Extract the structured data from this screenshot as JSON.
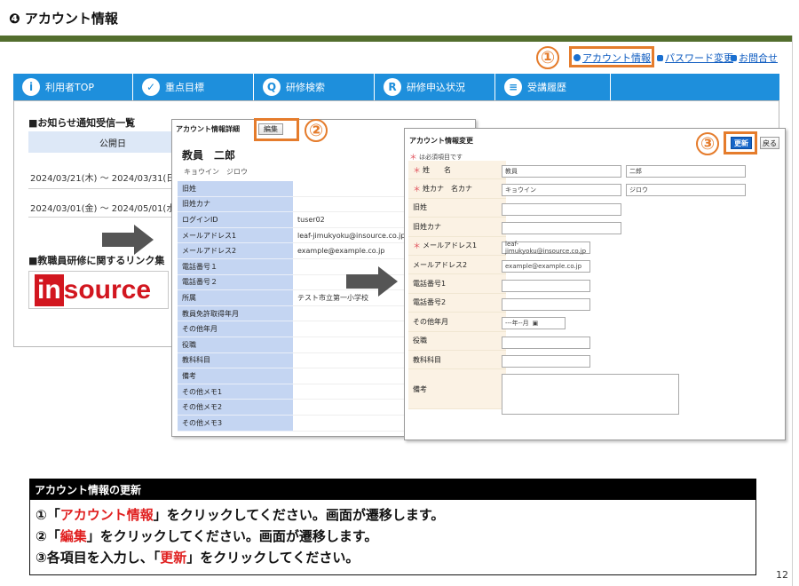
{
  "slide": {
    "title": "❹ アカウント情報",
    "page_number": "12"
  },
  "top_links": {
    "account": "アカウント情報",
    "password": "パスワード変更",
    "contact": "お問合せ"
  },
  "steps": {
    "one": "①",
    "two": "②",
    "three": "③"
  },
  "nav": {
    "items": [
      {
        "icon": "i",
        "label": "利用者TOP"
      },
      {
        "icon": "✓",
        "label": "重点目標"
      },
      {
        "icon": "Q",
        "label": "研修検索"
      },
      {
        "icon": "R",
        "label": "研修申込状況"
      },
      {
        "icon": "≡",
        "label": "受講履歴"
      }
    ]
  },
  "user_panel": {
    "notice_heading": "■お知らせ通知受信一覧",
    "notice_col": "公開日",
    "notice_rows": [
      "2024/03/21(木) ～ 2024/03/31(日)",
      "2024/03/01(金) ～ 2024/05/01(水)"
    ],
    "links_heading": "■教職員研修に関するリンク集",
    "logo_in": "in",
    "logo_rest": "source"
  },
  "detail": {
    "title": "アカウント情報詳細",
    "edit_button": "編集",
    "name": "教員　二郎",
    "kana": "キョウイン　ジロウ",
    "rows": [
      {
        "label": "旧姓",
        "value": ""
      },
      {
        "label": "旧姓カナ",
        "value": ""
      },
      {
        "label": "ログインID",
        "value": "tuser02"
      },
      {
        "label": "メールアドレス1",
        "value": "leaf-jimukyoku@insource.co.jp"
      },
      {
        "label": "メールアドレス2",
        "value": "example@example.co.jp"
      },
      {
        "label": "電話番号１",
        "value": ""
      },
      {
        "label": "電話番号２",
        "value": ""
      },
      {
        "label": "所属",
        "value": "テスト市立第一小学校"
      },
      {
        "label": "教員免許取得年月",
        "value": ""
      },
      {
        "label": "その他年月",
        "value": ""
      },
      {
        "label": "役職",
        "value": ""
      },
      {
        "label": "教科科目",
        "value": ""
      },
      {
        "label": "備考",
        "value": ""
      },
      {
        "label": "その他メモ1",
        "value": ""
      },
      {
        "label": "その他メモ2",
        "value": ""
      },
      {
        "label": "その他メモ3",
        "value": ""
      }
    ]
  },
  "edit": {
    "title": "アカウント情報変更",
    "required_note": "は必須項目です",
    "required_mark": "＊",
    "update_button": "更新",
    "back_button": "戻る",
    "rows": [
      {
        "label": "姓　　名",
        "required": true,
        "values": [
          "教員",
          "二郎"
        ]
      },
      {
        "label": "姓カナ　名カナ",
        "required": true,
        "values": [
          "キョウイン",
          "ジロウ"
        ]
      },
      {
        "label": "旧姓",
        "required": false,
        "values": [
          ""
        ]
      },
      {
        "label": "旧姓カナ",
        "required": false,
        "values": [
          ""
        ]
      },
      {
        "label": "メールアドレス1",
        "required": true,
        "values": [
          "leaf-jimukyoku@insource.co.jp"
        ]
      },
      {
        "label": "メールアドレス2",
        "required": false,
        "values": [
          "example@example.co.jp"
        ]
      },
      {
        "label": "電話番号1",
        "required": false,
        "values": [
          ""
        ]
      },
      {
        "label": "電話番号2",
        "required": false,
        "values": [
          ""
        ]
      },
      {
        "label": "その他年月",
        "required": false,
        "values": [
          "---年--月"
        ]
      },
      {
        "label": "役職",
        "required": false,
        "values": [
          ""
        ]
      },
      {
        "label": "教科科目",
        "required": false,
        "values": [
          ""
        ]
      },
      {
        "label": "備考",
        "required": false,
        "values": [
          ""
        ]
      }
    ]
  },
  "instructions": {
    "heading": "アカウント情報の更新",
    "line1_pre": "①「",
    "line1_hl": "アカウント情報",
    "line1_post": "」をクリックしてください。画面が遷移します。",
    "line2_pre": "②「",
    "line2_hl": "編集",
    "line2_post": "」をクリックしてください。画面が遷移します。",
    "line3_pre": "③各項目を入力し、「",
    "line3_hl": "更新",
    "line3_post": "」をクリックしてください。"
  }
}
